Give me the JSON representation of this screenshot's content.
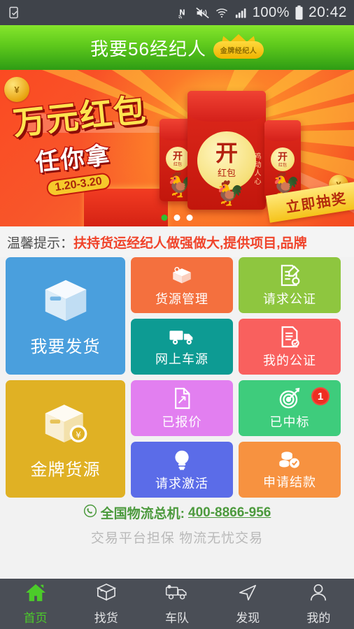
{
  "statusbar": {
    "left_icons": [
      "screenshot-icon"
    ],
    "nfc": "nfc-icon",
    "mute": "mute-icon",
    "wifi": "wifi-icon",
    "signal": "signal-icon",
    "battery_text": "100%",
    "battery": "battery-icon",
    "time": "20:42"
  },
  "header": {
    "title": "我要56经纪人",
    "badge_label": "金牌经纪人"
  },
  "banner": {
    "headline1": "万元红包",
    "headline2": "任你拿",
    "date_range": "1.20-3.20",
    "envelope_main_big": "开",
    "envelope_main_small": "红包",
    "envelope_side_big": "开",
    "envelope_side_small": "红包",
    "envelope_side_text": "鸡动人心",
    "ribbon": "立即抽奖",
    "dots": [
      {
        "active": true
      },
      {
        "active": false
      },
      {
        "active": false
      }
    ]
  },
  "notice": {
    "label": "温馨提示：",
    "text": "扶持货运经纪人做强做大,提供项目,品牌"
  },
  "grid": {
    "rows": [
      {
        "big": {
          "label": "我要发货",
          "icon": "box-icon",
          "color": "#4a9fdd"
        },
        "small": [
          {
            "label": "货源管理",
            "icon": "box-search-icon",
            "color": "#f4703e"
          },
          {
            "label": "请求公证",
            "icon": "document-edit-icon",
            "color": "#8ec63f"
          },
          {
            "label": "网上车源",
            "icon": "truck-icon",
            "color": "#0d9b93"
          },
          {
            "label": "我的公证",
            "icon": "document-check-icon",
            "color": "#f9605e"
          }
        ]
      },
      {
        "big": {
          "label": "金牌货源",
          "icon": "box-money-icon",
          "color": "#e0b124"
        },
        "small": [
          {
            "label": "已报价",
            "icon": "quote-document-icon",
            "color": "#e27ff0"
          },
          {
            "label": "已中标",
            "icon": "target-icon",
            "color": "#3ecc7c",
            "badge": "1"
          },
          {
            "label": "请求激活",
            "icon": "lightbulb-icon",
            "color": "#5b6ce8"
          },
          {
            "label": "申请结款",
            "icon": "coins-check-icon",
            "color": "#f79240"
          }
        ]
      }
    ]
  },
  "footer": {
    "hotline_icon": "phone-icon",
    "hotline_label": "全国物流总机:",
    "hotline_number": "400-8866-956",
    "slogan": "交易平台担保 物流无忧交易"
  },
  "bottomnav": {
    "items": [
      {
        "label": "首页",
        "icon": "home-icon",
        "active": true
      },
      {
        "label": "找货",
        "icon": "box-icon",
        "active": false
      },
      {
        "label": "车队",
        "icon": "truck-icon",
        "active": false
      },
      {
        "label": "发现",
        "icon": "compass-arrow-icon",
        "active": false
      },
      {
        "label": "我的",
        "icon": "person-icon",
        "active": false
      }
    ]
  },
  "colors": {
    "header_green_top": "#86e62c",
    "header_green_bottom": "#2e9c14",
    "notice_red": "#f0432a",
    "hotline_green": "#4c9a3d",
    "badge_red": "#ef2d21",
    "nav_bg": "#4a4e56",
    "nav_active": "#4ccb2a"
  }
}
